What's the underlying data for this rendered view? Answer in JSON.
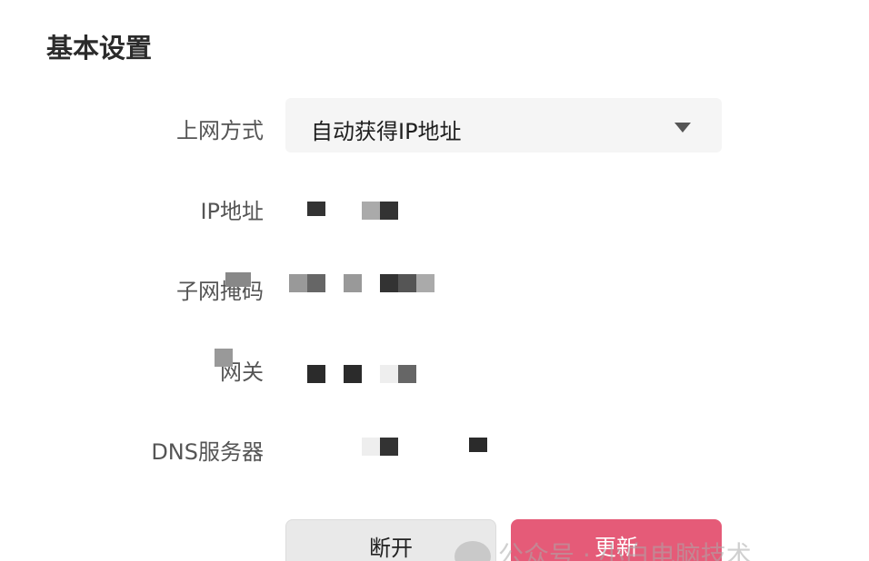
{
  "section": {
    "title": "基本设置"
  },
  "fields": {
    "connection_type": {
      "label": "上网方式",
      "value": "自动获得IP地址"
    },
    "ip_address": {
      "label": "IP地址"
    },
    "subnet_mask": {
      "label": "子网掩码"
    },
    "gateway": {
      "label": "网关"
    },
    "dns_server": {
      "label": "DNS服务器"
    }
  },
  "buttons": {
    "disconnect": "断开",
    "update": "更新"
  },
  "watermark": "公众号 · 小白电脑技术",
  "colors": {
    "accent": "#e55b78",
    "select_bg": "#f5f5f5",
    "button_bg": "#e9e9e9"
  },
  "icons": {
    "dropdown": "caret-down-icon",
    "watermark": "wechat-icon"
  }
}
